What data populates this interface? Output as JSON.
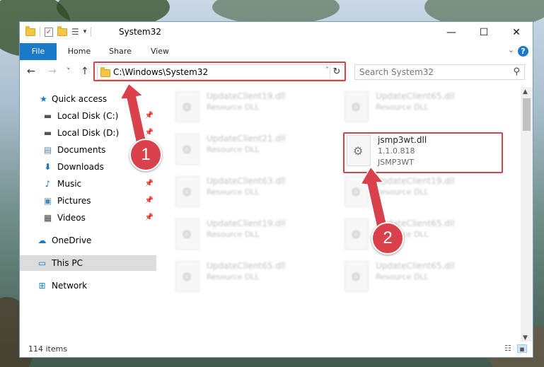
{
  "titlebar": {
    "title": "System32",
    "minimize_icon": "—",
    "maximize_icon": "☐",
    "close_icon": "✕"
  },
  "ribbon": {
    "tabs": [
      "File",
      "Home",
      "Share",
      "View"
    ],
    "help_icon": "?"
  },
  "nav": {
    "back_icon": "←",
    "forward_icon": "→",
    "recent_icon": "˅",
    "up_icon": "↑",
    "address": "C:\\Windows\\System32",
    "address_dropdown_icon": "˅",
    "refresh_icon": "↻",
    "search_placeholder": "Search System32"
  },
  "sidebar": {
    "items": [
      {
        "label": "Quick access",
        "icon": "star-icon"
      },
      {
        "label": "Local Disk (C:)",
        "icon": "drive-icon"
      },
      {
        "label": "Local Disk (D:)",
        "icon": "drive-icon"
      },
      {
        "label": "Documents",
        "icon": "document-icon"
      },
      {
        "label": "Downloads",
        "icon": "download-icon"
      },
      {
        "label": "Music",
        "icon": "music-icon"
      },
      {
        "label": "Pictures",
        "icon": "pictures-icon"
      },
      {
        "label": "Videos",
        "icon": "video-icon"
      },
      {
        "label": "OneDrive",
        "icon": "cloud-icon"
      },
      {
        "label": "This PC",
        "icon": "computer-icon"
      },
      {
        "label": "Network",
        "icon": "network-icon"
      }
    ]
  },
  "files": [
    {
      "name": "UpdateClient19.dll",
      "sub": "Resource DLL"
    },
    {
      "name": "UpdateClient65.dll",
      "sub": "Resource DLL"
    },
    {
      "name": "UpdateClient21.dll",
      "sub": "Resource DLL"
    },
    {
      "name": "jsmp3wt.dll",
      "sub": "1.1.0.818",
      "sub2": "JSMP3WT"
    },
    {
      "name": "UpdateClient63.dll",
      "sub": "Resource DLL"
    },
    {
      "name": "UpdateClient19.dll",
      "sub": "Resource DLL"
    },
    {
      "name": "UpdateClient19.dll",
      "sub": "Resource DLL"
    },
    {
      "name": "UpdateClient65.dll",
      "sub": "Resource DLL"
    },
    {
      "name": "UpdateClient65.dll",
      "sub": "Resource DLL"
    },
    {
      "name": "UpdateClient65.dll",
      "sub": "Resource DLL"
    }
  ],
  "status": {
    "item_count": "114 items"
  },
  "callouts": {
    "one": "1",
    "two": "2"
  },
  "colors": {
    "accent": "#1979ca",
    "highlight": "#d9414c"
  }
}
